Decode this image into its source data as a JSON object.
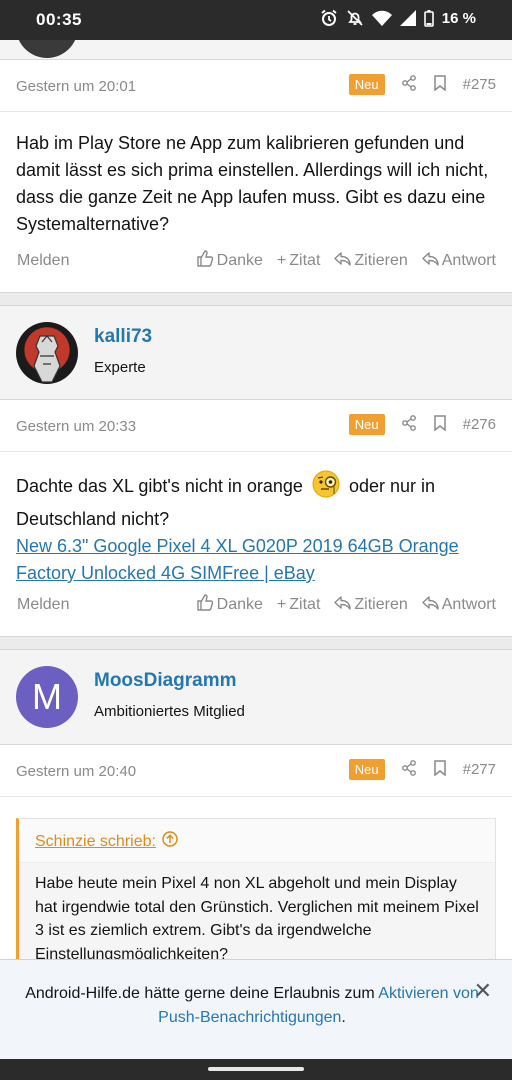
{
  "status_bar": {
    "time": "00:35",
    "battery": "16 %",
    "icons": [
      "alarm-icon",
      "bell-off-icon",
      "wifi-icon",
      "signal-icon",
      "battery-icon"
    ]
  },
  "post_275": {
    "date": "Gestern um 20:01",
    "badge": "Neu",
    "number": "#275",
    "text": "Hab im Play Store ne App zum kalibrieren gefunden und damit lässt es sich prima einstellen. Allerdings will ich nicht, dass die ganze Zeit ne App laufen muss. Gibt es dazu eine Systemalternative?"
  },
  "user_kalli73": {
    "name": "kalli73",
    "role": "Experte"
  },
  "post_276": {
    "date": "Gestern um 20:33",
    "badge": "Neu",
    "number": "#276",
    "text_before_emoji": "Dachte das XL gibt's nicht in orange",
    "text_after_emoji": "oder nur in Deutschland nicht?",
    "link": "New 6.3\" Google Pixel 4 XL G020P 2019 64GB Orange Factory Unlocked 4G SIMFree | eBay"
  },
  "user_moos": {
    "name": "MoosDiagramm",
    "role": "Ambitioniertes Mitglied",
    "initial": "M",
    "avatar_color": "#6b5fc2"
  },
  "post_277": {
    "date": "Gestern um 20:40",
    "badge": "Neu",
    "number": "#277",
    "quote_author": "Schinzie schrieb:",
    "quote_text": "Habe heute mein Pixel 4 non XL abgeholt und mein Display hat irgendwie total den Grünstich. Verglichen mit meinem Pixel 3 ist es ziemlich extrem. Gibt's da irgendwelche Einstellungsmöglichkeiten?"
  },
  "actions": {
    "report": "Melden",
    "thanks": "Danke",
    "add_quote": "Zitat",
    "quote": "Zitieren",
    "reply": "Antwort"
  },
  "push_banner": {
    "text": "Android-Hilfe.de hätte gerne deine Erlaubnis zum",
    "link": "Aktivieren von Push-Benachrichtigungen",
    "suffix": "."
  },
  "colors": {
    "accent_blue": "#2577b1",
    "badge_orange": "#f0a030"
  }
}
